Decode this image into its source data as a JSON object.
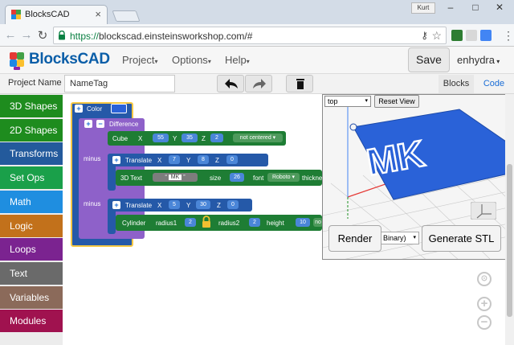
{
  "browser": {
    "tab_title": "BlocksCAD",
    "url_secure": "https://",
    "url_rest": "blockscad.einsteinsworkshop.com/#",
    "profile_name": "Kurt"
  },
  "app": {
    "logo_text": "BlocksCAD",
    "menu": {
      "project": "Project",
      "options": "Options",
      "help": "Help"
    },
    "save_label": "Save",
    "username": "enhydra"
  },
  "toolbar": {
    "project_name_label": "Project Name",
    "project_name_value": "NameTag",
    "blocks_tab": "Blocks",
    "code_tab": "Code"
  },
  "categories": [
    {
      "label": "3D Shapes",
      "color": "#1e8c1e"
    },
    {
      "label": "2D Shapes",
      "color": "#1e8c1e"
    },
    {
      "label": "Transforms",
      "color": "#235a9c"
    },
    {
      "label": "Set Ops",
      "color": "#1aa04a"
    },
    {
      "label": "Math",
      "color": "#1f8ee0"
    },
    {
      "label": "Logic",
      "color": "#c2711b"
    },
    {
      "label": "Loops",
      "color": "#7b2390"
    },
    {
      "label": "Text",
      "color": "#6a6a6a"
    },
    {
      "label": "Variables",
      "color": "#8b6a5a"
    },
    {
      "label": "Modules",
      "color": "#a0124f"
    }
  ],
  "blocks": {
    "color_label": "Color",
    "difference_label": "Difference",
    "minus1": "minus",
    "minus2": "minus",
    "cube": {
      "label": "Cube",
      "x_label": "X",
      "x": "55",
      "y_label": "Y",
      "y": "35",
      "z_label": "Z",
      "z": "2",
      "center": "not centered"
    },
    "translate1": {
      "label": "Translate",
      "x_label": "X",
      "x": "7",
      "y_label": "Y",
      "y": "8",
      "z_label": "Z",
      "z": "0"
    },
    "text3d": {
      "label": "3D Text",
      "open_quote": "“",
      "text": "MK",
      "close_quote": "”",
      "size_label": "size",
      "size": "26",
      "font_label": "font",
      "font": "Roboto",
      "thickness_label": "thickne"
    },
    "translate2": {
      "label": "Translate",
      "x_label": "X",
      "x": "5",
      "y_label": "Y",
      "y": "30",
      "z_label": "Z",
      "z": "0"
    },
    "cylinder": {
      "label": "Cylinder",
      "r1_label": "radius1",
      "r1": "2",
      "r2_label": "radius2",
      "r2": "2",
      "height_label": "height",
      "height": "10",
      "center_trunc": "no"
    }
  },
  "viewer": {
    "view_option": "top",
    "reset_label": "Reset View",
    "render_label": "Render",
    "format_value": "Binary)",
    "generate_label": "Generate STL",
    "model_text": "MK",
    "model_color": "#2a62d8"
  }
}
